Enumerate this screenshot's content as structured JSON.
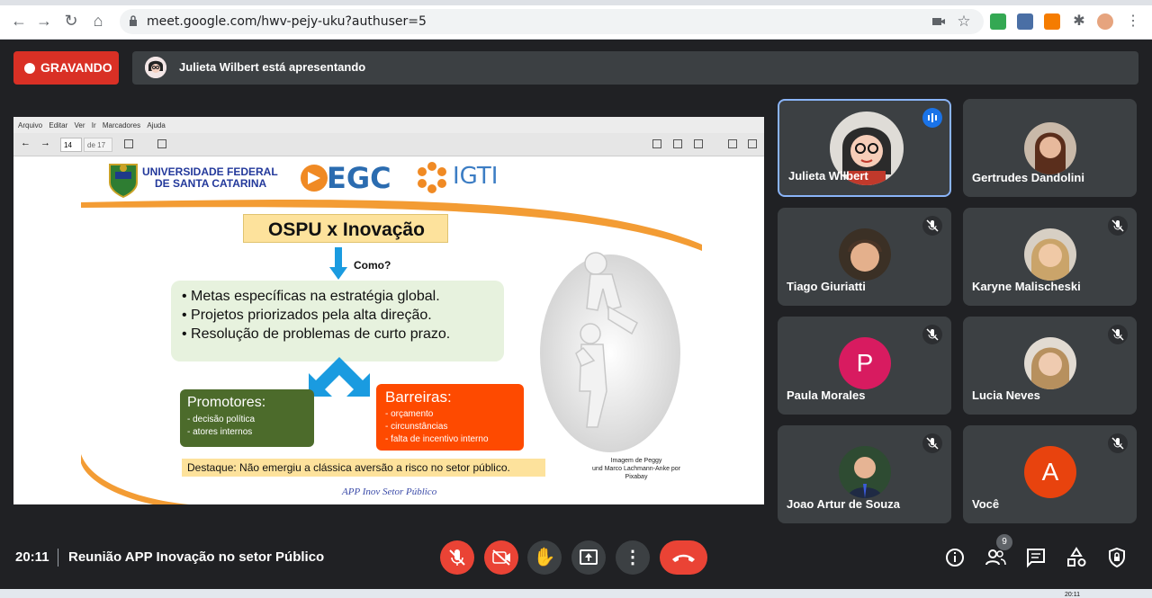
{
  "browser": {
    "url": "meet.google.com/hwv-pejy-uku?authuser=5",
    "icons": [
      "back-icon",
      "forward-icon",
      "reload-icon",
      "home-icon",
      "lock-icon",
      "camera-icon",
      "star-icon",
      "extension-icon",
      "avatar"
    ]
  },
  "recording": {
    "label": "GRAVANDO"
  },
  "presenting": {
    "text": "Julieta Wilbert está apresentando"
  },
  "viewer": {
    "menu": [
      "Arquivo",
      "Editar",
      "Ver",
      "Ir",
      "Marcadores",
      "Ajuda"
    ],
    "page": "14",
    "page_of": "de 17"
  },
  "slide": {
    "ufsc_line1": "UNIVERSIDADE FEDERAL",
    "ufsc_line2": "DE SANTA CATARINA",
    "egc": "EGC",
    "igti": "IGTI",
    "title": "OSPU x Inovação",
    "como": "Como?",
    "bullets": [
      "•  Metas específicas na estratégia global.",
      "•  Projetos priorizados pela alta direção.",
      "•  Resolução de problemas de curto prazo."
    ],
    "promotores": {
      "title": "Promotores:",
      "items": [
        "- decisão política",
        "- atores internos"
      ]
    },
    "barreiras": {
      "title": "Barreiras:",
      "items": [
        "- orçamento",
        "- circunstâncias",
        "- falta de incentivo interno"
      ]
    },
    "destaque": "Destaque: Não emergiu a clássica aversão a risco no setor público.",
    "footer": "APP Inov Setor Público",
    "credit_line1": "Imagem de Peggy",
    "credit_line2": "und Marco Lachmann-Anke por",
    "credit_line3": "Pixabay"
  },
  "participants": [
    {
      "name": "Julieta Wilbert",
      "state": "speaking"
    },
    {
      "name": "Gertrudes Dandolini",
      "state": "unmuted"
    },
    {
      "name": "Tiago Giuriatti",
      "state": "muted"
    },
    {
      "name": "Karyne Malischeski",
      "state": "muted"
    },
    {
      "name": "Paula Morales",
      "state": "muted",
      "initial": "P",
      "color": "#d81b60"
    },
    {
      "name": "Lucia Neves",
      "state": "muted"
    },
    {
      "name": "Joao Artur de Souza",
      "state": "muted"
    },
    {
      "name": "Você",
      "state": "muted",
      "initial": "A",
      "color": "#e8430e"
    }
  ],
  "bottom": {
    "time": "20:11",
    "title": "Reunião APP Inovação no setor Público",
    "people_count": "9"
  },
  "taskbar": {
    "clock": "20:11"
  }
}
